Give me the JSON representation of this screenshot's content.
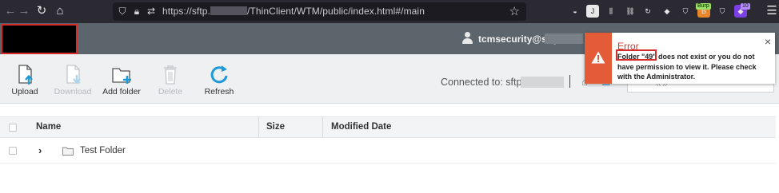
{
  "browser": {
    "back_glyph": "←",
    "forward_glyph": "→",
    "reload_glyph": "↻",
    "home_glyph": "⌂",
    "url_prefix": "https://sftp.",
    "url_suffix": "/ThinClient/WTM/public/index.html#/main",
    "star_glyph": "☆",
    "extensions": [
      {
        "name": "pocket-icon",
        "glyph": "◒",
        "bg": "#2b2a33"
      },
      {
        "name": "profile-icon",
        "glyph": "J",
        "bg": "#e8e8e8"
      },
      {
        "name": "library-icon",
        "glyph": "⫼",
        "bg": "#2b2a33"
      },
      {
        "name": "link-extension-icon",
        "glyph": "⛓",
        "bg": "#2b2a33"
      },
      {
        "name": "refresh-extension-icon",
        "glyph": "↻",
        "bg": "#2b2a33"
      },
      {
        "name": "wappalyzer-icon",
        "glyph": "◆",
        "bg": "#2b2a33"
      },
      {
        "name": "shield-extension-icon",
        "glyph": "⛉",
        "bg": "#2b2a33"
      },
      {
        "name": "burp-extension-icon",
        "glyph": "B",
        "bg": "#e8862a",
        "badge": "Burp"
      },
      {
        "name": "ublock-icon",
        "glyph": "⛉",
        "bg": "#2b2a33"
      },
      {
        "name": "foxyproxy-icon",
        "glyph": "◆",
        "bg": "#7b3fe4",
        "badge": "10"
      }
    ],
    "menu_glyph": "☰"
  },
  "header": {
    "username": "tcmsecurity@sftp"
  },
  "toolbar": {
    "buttons": [
      {
        "label": "Upload",
        "enabled": true
      },
      {
        "label": "Download",
        "enabled": false
      },
      {
        "label": "Add folder",
        "enabled": true
      },
      {
        "label": "Delete",
        "enabled": false
      },
      {
        "label": "Refresh",
        "enabled": true
      }
    ],
    "connected_label": "Connected to: sftp",
    "search_placeholder": "(( ))"
  },
  "table": {
    "columns": [
      "Name",
      "Size",
      "Modified Date"
    ],
    "rows": [
      {
        "name": "Test Folder",
        "size": "",
        "modified": ""
      }
    ]
  },
  "toast": {
    "title": "Error",
    "highlighted_text": "Folder \"49\"",
    "message": "Folder \"49\" does not exist or you do not have permission to view it. Please check with the Administrator.",
    "close_glyph": "×",
    "accent_color": "#e35b37"
  }
}
